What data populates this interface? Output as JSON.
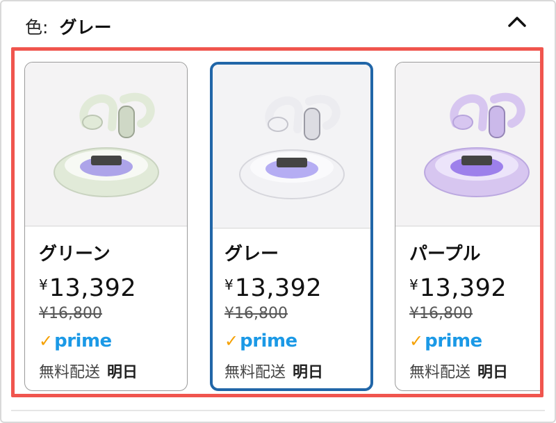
{
  "header": {
    "label": "色:",
    "value": "グレー",
    "collapse_icon": "chevron-up-icon"
  },
  "variants": [
    {
      "name": "グリーン",
      "currency": "¥",
      "price": "13,392",
      "list_price": "¥16,800",
      "prime": "prime",
      "shipping_label": "無料配送",
      "shipping_when": "明日",
      "selected": false,
      "body_color": "#e1ead8",
      "accent_color": "#9a8fe6"
    },
    {
      "name": "グレー",
      "currency": "¥",
      "price": "13,392",
      "list_price": "¥16,800",
      "prime": "prime",
      "shipping_label": "無料配送",
      "shipping_when": "明日",
      "selected": true,
      "body_color": "#f2f2f5",
      "accent_color": "#a49af0"
    },
    {
      "name": "パープル",
      "currency": "¥",
      "price": "13,392",
      "list_price": "¥16,800",
      "prime": "prime",
      "shipping_label": "無料配送",
      "shipping_when": "明日",
      "selected": false,
      "body_color": "#d7c6f0",
      "accent_color": "#8f6fe8"
    }
  ],
  "colors": {
    "selected_border": "#2166a8",
    "highlight_border": "#f0554e",
    "prime_blue": "#1b99e6",
    "prime_check": "#f5a000"
  }
}
